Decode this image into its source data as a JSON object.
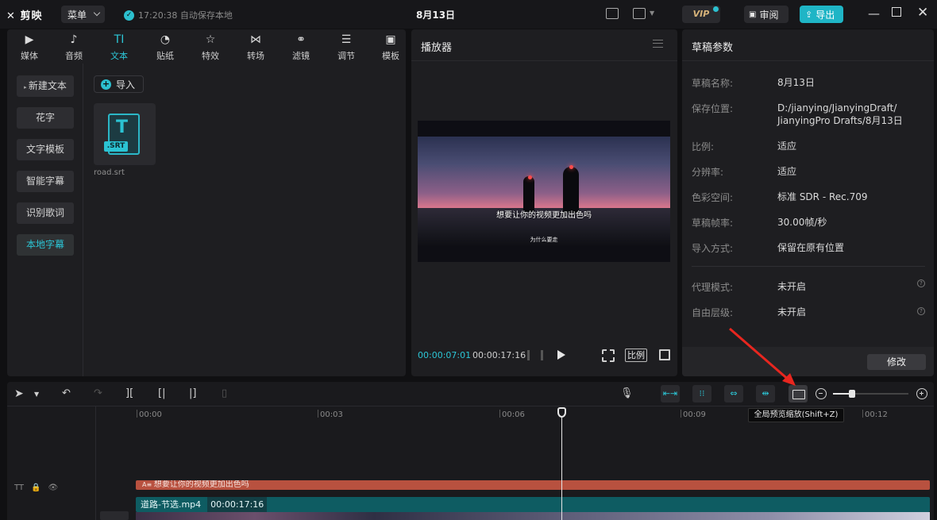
{
  "app": {
    "logo": "剪映",
    "menu_label": "菜单",
    "autosave_text": "17:20:38 自动保存本地",
    "project_title": "8月13日",
    "vip_label": "VIP",
    "review_label": "审阅",
    "export_label": "导出"
  },
  "toolbar_tabs": [
    {
      "label": "媒体",
      "icon": "media-icon",
      "glyph": "▶"
    },
    {
      "label": "音频",
      "icon": "audio-icon",
      "glyph": "♪"
    },
    {
      "label": "文本",
      "icon": "text-icon",
      "glyph": "TI"
    },
    {
      "label": "贴纸",
      "icon": "sticker-icon",
      "glyph": "◔"
    },
    {
      "label": "特效",
      "icon": "effects-icon",
      "glyph": "☆"
    },
    {
      "label": "转场",
      "icon": "transition-icon",
      "glyph": "⋈"
    },
    {
      "label": "滤镜",
      "icon": "filter-icon",
      "glyph": "⚭"
    },
    {
      "label": "调节",
      "icon": "adjust-icon",
      "glyph": "☰"
    },
    {
      "label": "模板",
      "icon": "template-icon",
      "glyph": "▣"
    }
  ],
  "sidebar": {
    "items": [
      {
        "label": "新建文本"
      },
      {
        "label": "花字"
      },
      {
        "label": "文字模板"
      },
      {
        "label": "智能字幕"
      },
      {
        "label": "识别歌词"
      },
      {
        "label": "本地字幕"
      }
    ],
    "active": "本地字幕"
  },
  "media": {
    "import_label": "导入",
    "file_tag": ".SRT",
    "file_name": "road.srt"
  },
  "player": {
    "title": "播放器",
    "subtitle_main": "想要让你的视频更加出色吗",
    "subtitle_small": "为什么要走",
    "current_time": "00:00:07:01",
    "total_time": "00:00:17:16",
    "ratio_label": "比例"
  },
  "properties": {
    "title": "草稿参数",
    "rows": [
      {
        "label": "草稿名称:",
        "value": "8月13日"
      },
      {
        "label": "保存位置:",
        "value": "D:/jianying/JianyingDraft/\nJianyingPro Drafts/8月13日"
      },
      {
        "label": "比例:",
        "value": "适应"
      },
      {
        "label": "分辨率:",
        "value": "适应"
      },
      {
        "label": "色彩空间:",
        "value": "标准 SDR - Rec.709"
      },
      {
        "label": "草稿帧率:",
        "value": "30.00帧/秒"
      },
      {
        "label": "导入方式:",
        "value": "保留在原有位置"
      }
    ],
    "extra_rows": [
      {
        "label": "代理模式:",
        "value": "未开启"
      },
      {
        "label": "自由层级:",
        "value": "未开启"
      }
    ],
    "modify_label": "修改"
  },
  "timeline": {
    "tooltip": "全局预览缩放(Shift+Z)",
    "ruler": [
      "00:00",
      "00:03",
      "00:06",
      "00:09",
      "00:12"
    ],
    "text_clip_label": "想要让你的视频更加出色吗",
    "video_clip_name": "道路-节选.mp4",
    "video_clip_duration": "00:00:17:16",
    "zoom_level": 0.25
  },
  "colors": {
    "accent": "#2cc6d6",
    "text_clip": "#b8513f",
    "video_clip": "#0e5c62",
    "annotation_arrow": "#e8261f"
  }
}
